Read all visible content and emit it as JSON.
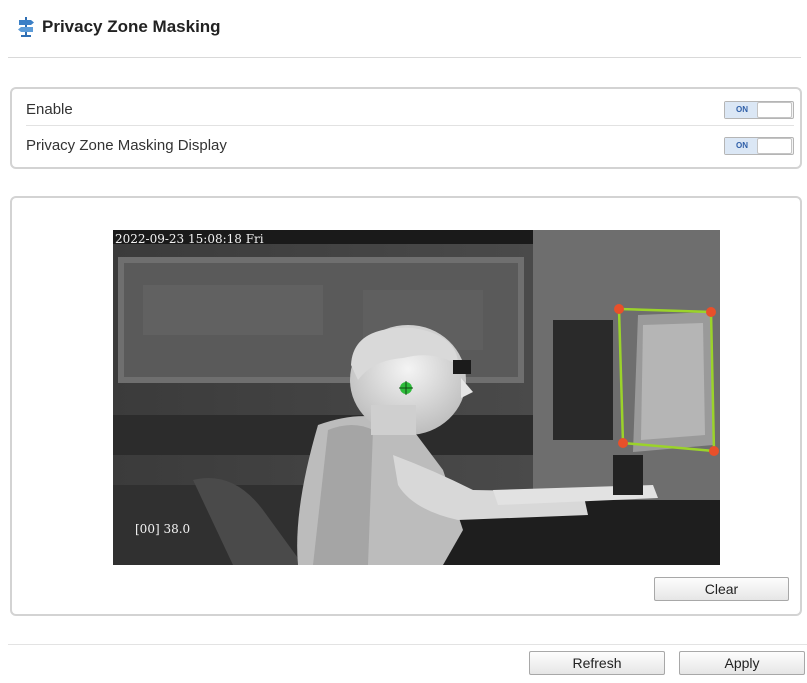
{
  "header": {
    "title": "Privacy Zone Masking",
    "icon": "signpost-icon"
  },
  "settings": {
    "items": [
      {
        "label": "Enable",
        "toggle_text": "ON",
        "state": "on"
      },
      {
        "label": "Privacy Zone Masking Display",
        "toggle_text": "ON",
        "state": "on"
      }
    ]
  },
  "video": {
    "timestamp": "2022-09-23 15:08:18 Fri",
    "temperature_readout": "[00] 38.0",
    "mask_color": "#9bd32a",
    "corner_color": "#e8502a"
  },
  "buttons": {
    "clear": "Clear",
    "refresh": "Refresh",
    "apply": "Apply"
  }
}
